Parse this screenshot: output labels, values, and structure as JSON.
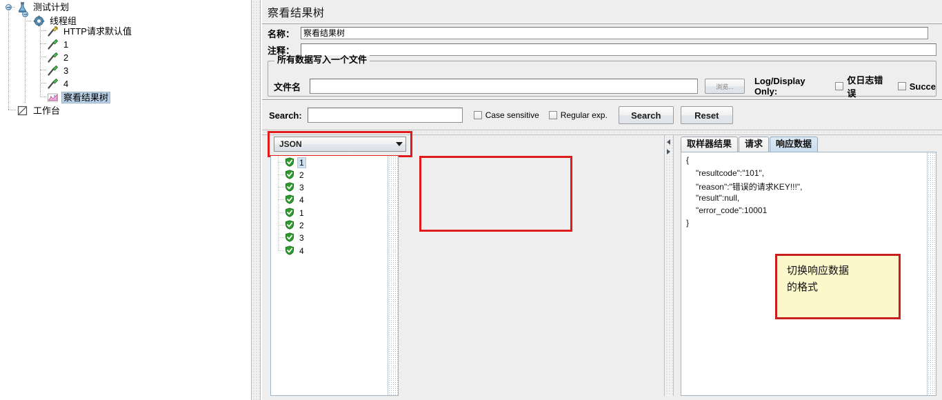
{
  "tree": {
    "nodes": [
      {
        "label": "测试计划",
        "icon": "flask-icon",
        "depth": 0,
        "selected": false
      },
      {
        "label": "线程组",
        "icon": "gear-icon",
        "depth": 1,
        "selected": false
      },
      {
        "label": "HTTP请求默认值",
        "icon": "http-defaults-icon",
        "depth": 2,
        "selected": false
      },
      {
        "label": "1",
        "icon": "sampler-icon",
        "depth": 2,
        "selected": false
      },
      {
        "label": "2",
        "icon": "sampler-icon",
        "depth": 2,
        "selected": false
      },
      {
        "label": "3",
        "icon": "sampler-icon",
        "depth": 2,
        "selected": false
      },
      {
        "label": "4",
        "icon": "sampler-icon",
        "depth": 2,
        "selected": false
      },
      {
        "label": "察看结果树",
        "icon": "listener-icon",
        "depth": 2,
        "selected": true
      },
      {
        "label": "工作台",
        "icon": "workbench-icon",
        "depth": 0,
        "selected": false
      }
    ]
  },
  "panel": {
    "title": "察看结果树",
    "name_label": "名称：",
    "name_value": "察看结果树",
    "comment_label": "注释：",
    "comment_value": ""
  },
  "filegroup": {
    "legend": "所有数据写入一个文件",
    "filename_label": "文件名",
    "filename_value": "",
    "browse_label": "浏览...",
    "logdisplay_label": "Log/Display Only:",
    "errors_only_label": "仅日志错误",
    "success_label": "Succe",
    "errors_only_checked": false,
    "success_checked": false
  },
  "search": {
    "label": "Search:",
    "value": "",
    "case_sensitive_label": "Case sensitive",
    "case_sensitive_checked": false,
    "regex_label": "Regular exp.",
    "regex_checked": false,
    "search_button": "Search",
    "reset_button": "Reset"
  },
  "renderer": {
    "selected": "JSON"
  },
  "results": [
    {
      "num": "1",
      "status": "success",
      "selected": true
    },
    {
      "num": "2",
      "status": "success",
      "selected": false
    },
    {
      "num": "3",
      "status": "success",
      "selected": false
    },
    {
      "num": "4",
      "status": "success",
      "selected": false
    },
    {
      "num": "1",
      "status": "success",
      "selected": false
    },
    {
      "num": "2",
      "status": "success",
      "selected": false
    },
    {
      "num": "3",
      "status": "success",
      "selected": false
    },
    {
      "num": "4",
      "status": "success",
      "selected": false
    }
  ],
  "tabs": [
    {
      "label": "取样器结果",
      "active": false
    },
    {
      "label": "请求",
      "active": false
    },
    {
      "label": "响应数据",
      "active": true
    }
  ],
  "response": {
    "lines": [
      "{",
      "    \"resultcode\":\"101\",",
      "    \"reason\":\"错误的请求KEY!!!\",",
      "    \"result\":null,",
      "    \"error_code\":10001",
      "}"
    ],
    "line0": "{",
    "line1": "\"resultcode\":\"101\",",
    "line2": "\"reason\":\"错误的请求KEY!!!\",",
    "line3": "\"result\":null,",
    "line4": "\"error_code\":10001",
    "line5": "}"
  },
  "annotation": {
    "line1": "切换响应数据",
    "line2": "的格式"
  },
  "colors": {
    "highlight_red": "#e01b1b",
    "note_yellow": "#fbf8cc",
    "panel_gray": "#eeeeee",
    "selection_blue": "#b8cfe5",
    "success_green": "#2e9b2e"
  }
}
